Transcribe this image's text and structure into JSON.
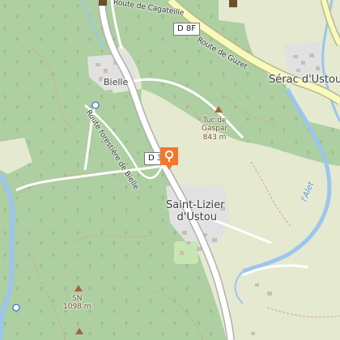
{
  "map": {
    "places": {
      "bielle": "Bielle",
      "serac": "Sérac d'Ustou",
      "saint_lizier_line1": "Saint-Lizier",
      "saint_lizier_line2": "d'Ustou"
    },
    "peaks": {
      "tuc_name_line1": "Tuc de",
      "tuc_name_line2": "Gaspar",
      "tuc_elev": "843 m",
      "sn_name": "SN",
      "sn_elev": "1098 m"
    },
    "roads": {
      "cagateille": "Route de Cagateille",
      "guzet": "Route de Guzet",
      "forestiere": "Route forestière de Bielle",
      "d8f": "D 8F",
      "d38": "D 38"
    },
    "waterways": {
      "alet": "l'Alet"
    },
    "colors": {
      "forest": "#adcfa1",
      "meadow": "#e4e9d0",
      "residential": "#e1e1e1",
      "water": "#9cc6ee",
      "primary_road": "#f7f9bd",
      "marker": "#f4762b"
    },
    "marker_icon": "location-pin-icon"
  }
}
